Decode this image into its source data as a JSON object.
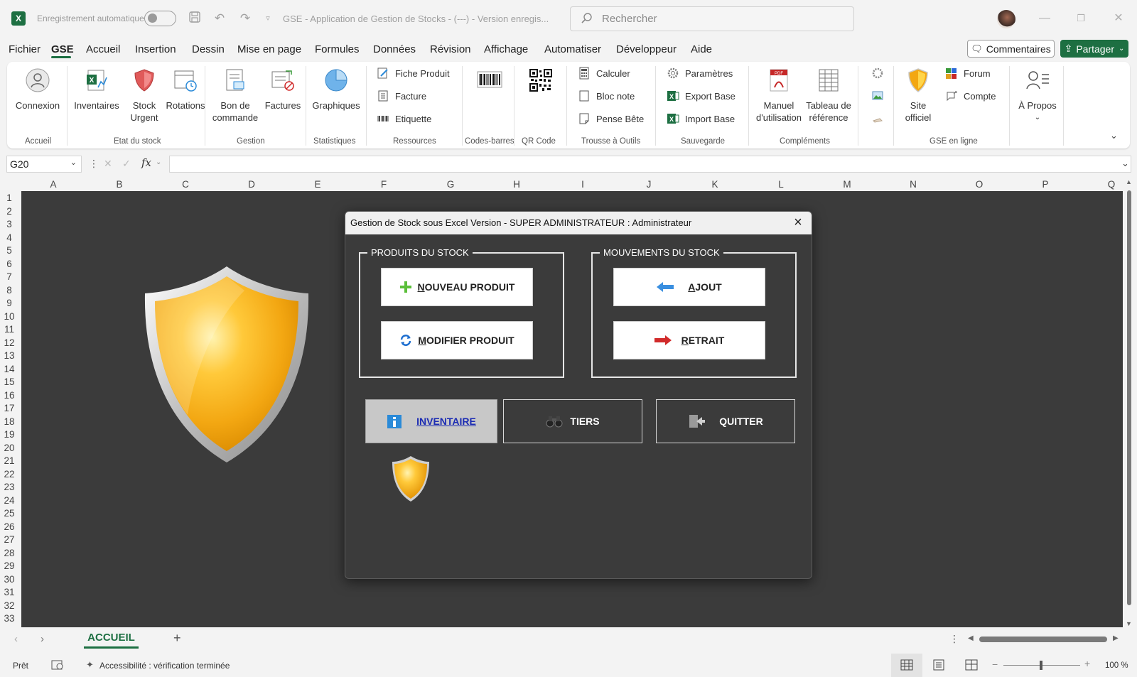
{
  "app": {
    "autosave_label": "Enregistrement automatique",
    "doc_title": "GSE - Application de Gestion de Stocks - (---) - Version enregis...",
    "search_placeholder": "Rechercher"
  },
  "menu": {
    "tabs": [
      "Fichier",
      "GSE",
      "Accueil",
      "Insertion",
      "Dessin",
      "Mise en page",
      "Formules",
      "Données",
      "Révision",
      "Affichage",
      "Automatiser",
      "Développeur",
      "Aide"
    ],
    "active": "GSE",
    "comments_label": "Commentaires",
    "share_label": "Partager"
  },
  "ribbon": {
    "connexion": "Connexion",
    "inventaires": "Inventaires",
    "stock_urgent_1": "Stock",
    "stock_urgent_2": "Urgent",
    "rotations": "Rotations",
    "bon_1": "Bon de",
    "bon_2": "commande",
    "factures": "Factures",
    "graphiques": "Graphiques",
    "fiche_produit": "Fiche Produit",
    "facture": "Facture",
    "etiquette": "Etiquette",
    "calculer": "Calculer",
    "bloc_note": "Bloc note",
    "pense_bete": "Pense Bête",
    "parametres": "Paramètres",
    "export_base": "Export Base",
    "import_base": "Import Base",
    "manuel_1": "Manuel",
    "manuel_2": "d'utilisation",
    "tableau_1": "Tableau de",
    "tableau_2": "référence",
    "site_1": "Site",
    "site_2": "officiel",
    "forum": "Forum",
    "compte": "Compte",
    "apropos": "À Propos",
    "groups": {
      "accueil": "Accueil",
      "etat": "Etat du stock",
      "gestion": "Gestion",
      "statistiques": "Statistiques",
      "ressources": "Ressources",
      "codes_barres": "Codes-barres",
      "qr_code": "QR Code",
      "trousse": "Trousse à Outils",
      "sauvegarde": "Sauvegarde",
      "complements": "Compléments",
      "gse_en_ligne": "GSE en ligne"
    }
  },
  "formula_bar": {
    "name_box": "G20",
    "fx": "fx",
    "value": ""
  },
  "columns": [
    "A",
    "B",
    "C",
    "D",
    "E",
    "F",
    "G",
    "H",
    "I",
    "J",
    "K",
    "L",
    "M",
    "N",
    "O",
    "P",
    "Q"
  ],
  "rows": [
    "1",
    "2",
    "3",
    "4",
    "5",
    "6",
    "7",
    "8",
    "9",
    "10",
    "11",
    "12",
    "13",
    "14",
    "15",
    "16",
    "17",
    "18",
    "19",
    "20",
    "21",
    "22",
    "23",
    "24",
    "25",
    "26",
    "27",
    "28",
    "29",
    "30",
    "31",
    "32",
    "33"
  ],
  "dialog": {
    "title": "Gestion de Stock sous Excel Version - SUPER ADMINISTRATEUR : Administrateur",
    "produits_legend": "PRODUITS DU STOCK",
    "mouvements_legend": "MOUVEMENTS DU STOCK",
    "nouveau_key": "N",
    "nouveau_rest": "OUVEAU PRODUIT",
    "modifier_key": "M",
    "modifier_rest": "ODIFIER PRODUIT",
    "ajout_key": "A",
    "ajout_rest": "JOUT",
    "retrait_key": "R",
    "retrait_rest": "ETRAIT",
    "inventaire": "INVENTAIRE",
    "tiers_key": "T",
    "tiers_rest": "IERS",
    "quitter_key": "Q",
    "quitter_rest": "UITTER"
  },
  "sheet_tabs": {
    "active": "ACCUEIL"
  },
  "status": {
    "ready": "Prêt",
    "accessibility": "Accessibilité : vérification terminée",
    "zoom": "100 %"
  },
  "colors": {
    "excel_green": "#1d6f42",
    "sheet_bg": "#3b3b3b",
    "shield_gold": "#f5b800"
  }
}
